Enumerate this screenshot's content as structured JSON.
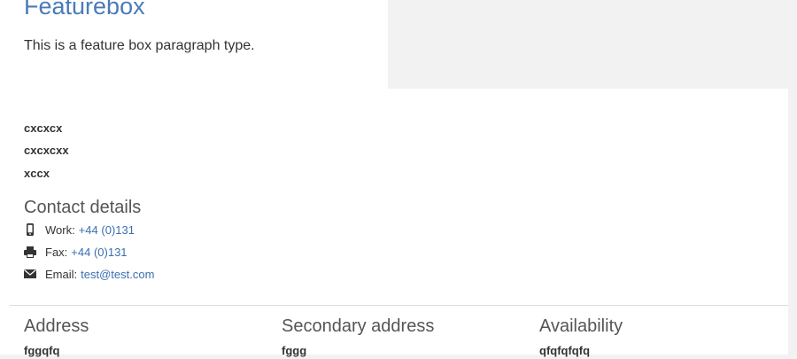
{
  "featurebox": {
    "title": "Featurebox",
    "text": "This is a feature box paragraph type."
  },
  "info_lines": [
    "cxcxcx",
    "cxcxcxx",
    "xccx"
  ],
  "contact": {
    "heading": "Contact details",
    "work": {
      "label": "Work:",
      "value": "+44 (0)131",
      "icon": "mobile-phone-icon"
    },
    "fax": {
      "label": "Fax:",
      "value": "+44 (0)131",
      "icon": "printer-icon"
    },
    "email": {
      "label": "Email:",
      "value": "test@test.com",
      "icon": "envelope-icon"
    }
  },
  "address": {
    "heading": "Address",
    "value": "fggqfq"
  },
  "secondary_address": {
    "heading": "Secondary address",
    "value": "fggg"
  },
  "availability": {
    "heading": "Availability",
    "value": "qfqfqfqfq"
  },
  "colors": {
    "link": "#3b6fb0",
    "title": "#4a7bb8",
    "background": "#f2f2f2",
    "panel": "#ffffff"
  }
}
